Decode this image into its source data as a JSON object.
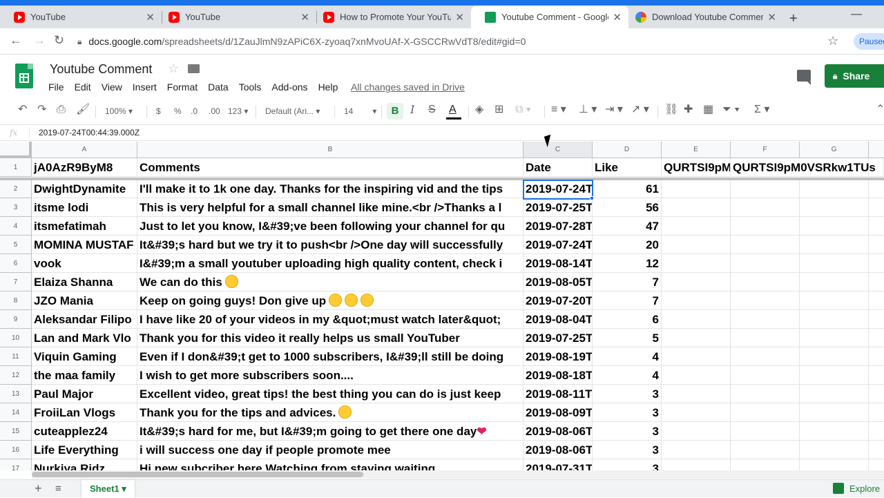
{
  "browser": {
    "tabs": [
      {
        "title": "YouTube",
        "favicon": "youtube-icon"
      },
      {
        "title": "YouTube",
        "favicon": "youtube-icon"
      },
      {
        "title": "How to Promote Your YouTube",
        "favicon": "youtube-icon"
      },
      {
        "title": "Youtube Comment - Google Sh",
        "favicon": "sheets-icon",
        "active": true
      },
      {
        "title": "Download Youtube Comments",
        "favicon": "tool-icon"
      }
    ],
    "url_host": "docs.google.com",
    "url_path": "/spreadsheets/d/1ZauJlmN9zAPiC6X-zyoaq7xnMvoUAf-X-GSCCRwVdT8/edit#gid=0",
    "profile_status": "Paused"
  },
  "doc": {
    "title": "Youtube Comment",
    "menu": [
      "File",
      "Edit",
      "View",
      "Insert",
      "Format",
      "Data",
      "Tools",
      "Add-ons",
      "Help"
    ],
    "saved_status": "All changes saved in Drive",
    "share_label": "Share"
  },
  "toolbar": {
    "zoom": "100%",
    "currency": "$",
    "percent": "%",
    "dec_decrease": ".0",
    "dec_increase": ".00",
    "more_formats": "123",
    "font": "Default (Ari...",
    "font_size": "14",
    "bold": "B",
    "italic": "I",
    "strike": "S",
    "text_color": "A"
  },
  "formula_bar": {
    "fx": "fx",
    "value": "2019-07-24T00:44:39.000Z"
  },
  "sheet": {
    "columns": [
      "A",
      "B",
      "C",
      "D",
      "E",
      "F",
      "G"
    ],
    "selected_cell": "C2",
    "rows": [
      {
        "n": "1",
        "a": "jA0AzR9ByM8",
        "b": "Comments",
        "c": "Date",
        "d": "Like",
        "e": "QURTSI9pM",
        "f": "QURTSI9pM0VSRkw1TUs"
      },
      {
        "n": "2",
        "a": "DwightDynamite",
        "b": "I'll make it to 1k one day. Thanks for the inspiring vid and the tips",
        "c": "2019-07-24T",
        "d": "61"
      },
      {
        "n": "3",
        "a": "itsme lodi",
        "b": "This is very helpful for a small channel like mine.<br />Thanks a l",
        "c": "2019-07-25T",
        "d": "56"
      },
      {
        "n": "4",
        "a": "itsmefatimah",
        "b": "Just to let you know, I&#39;ve been following your channel for qu",
        "c": "2019-07-28T",
        "d": "47"
      },
      {
        "n": "5",
        "a": "MOMINA MUSTAF",
        "b": "It&#39;s hard but we try it to push<br />One day will successfully",
        "c": "2019-07-24T",
        "d": "20"
      },
      {
        "n": "6",
        "a": "vook",
        "b": "I&#39;m a small youtuber uploading high quality content, check i",
        "c": "2019-08-14T",
        "d": "12"
      },
      {
        "n": "7",
        "a": "Elaiza Shanna",
        "b": "We can do this",
        "c": "2019-08-05T",
        "d": "7",
        "emoji": 1
      },
      {
        "n": "8",
        "a": "JZO Mania",
        "b": "Keep on going guys! Don give up",
        "c": "2019-07-20T",
        "d": "7",
        "emoji": 3
      },
      {
        "n": "9",
        "a": "Aleksandar Filipo",
        "b": "I have like 20 of your videos in my &quot;must watch later&quot;",
        "c": "2019-08-04T",
        "d": "6"
      },
      {
        "n": "10",
        "a": "Lan and Mark Vlo",
        "b": "Thank you for this video it really helps us small YouTuber",
        "c": "2019-07-25T",
        "d": "5"
      },
      {
        "n": "11",
        "a": "Viquin Gaming",
        "b": "Even if I don&#39;t get to 1000 subscribers, I&#39;ll still be doing",
        "c": "2019-08-19T",
        "d": "4"
      },
      {
        "n": "12",
        "a": "the maa family",
        "b": "I wish to get more subscribers soon....",
        "c": "2019-08-18T",
        "d": "4"
      },
      {
        "n": "13",
        "a": "Paul Major",
        "b": "Excellent video, great tips! the best thing you can do is just keep",
        "c": "2019-08-11T",
        "d": "3"
      },
      {
        "n": "14",
        "a": "FroiiLan Vlogs",
        "b": "Thank you for the tips and advices.",
        "c": "2019-08-09T",
        "d": "3",
        "emoji": 1
      },
      {
        "n": "15",
        "a": "cuteapplez24",
        "b": "It&#39;s hard for me, but I&#39;m going to get there one day",
        "c": "2019-08-06T",
        "d": "3",
        "heart": true
      },
      {
        "n": "16",
        "a": "Life Everything",
        "b": "i will success one day if people promote mee",
        "c": "2019-08-06T",
        "d": "3"
      },
      {
        "n": "17",
        "a": "Nurkiya Ridz",
        "b": "Hi new subcriber here Watching from staying waiting",
        "c": "2019-07-31T",
        "d": "3"
      }
    ],
    "sheet_tab": "Sheet1",
    "explore_label": "Explore"
  },
  "colors": {
    "accent": "#1a73e8",
    "sheets_green": "#188038",
    "grid_line": "#e2e3e3"
  }
}
